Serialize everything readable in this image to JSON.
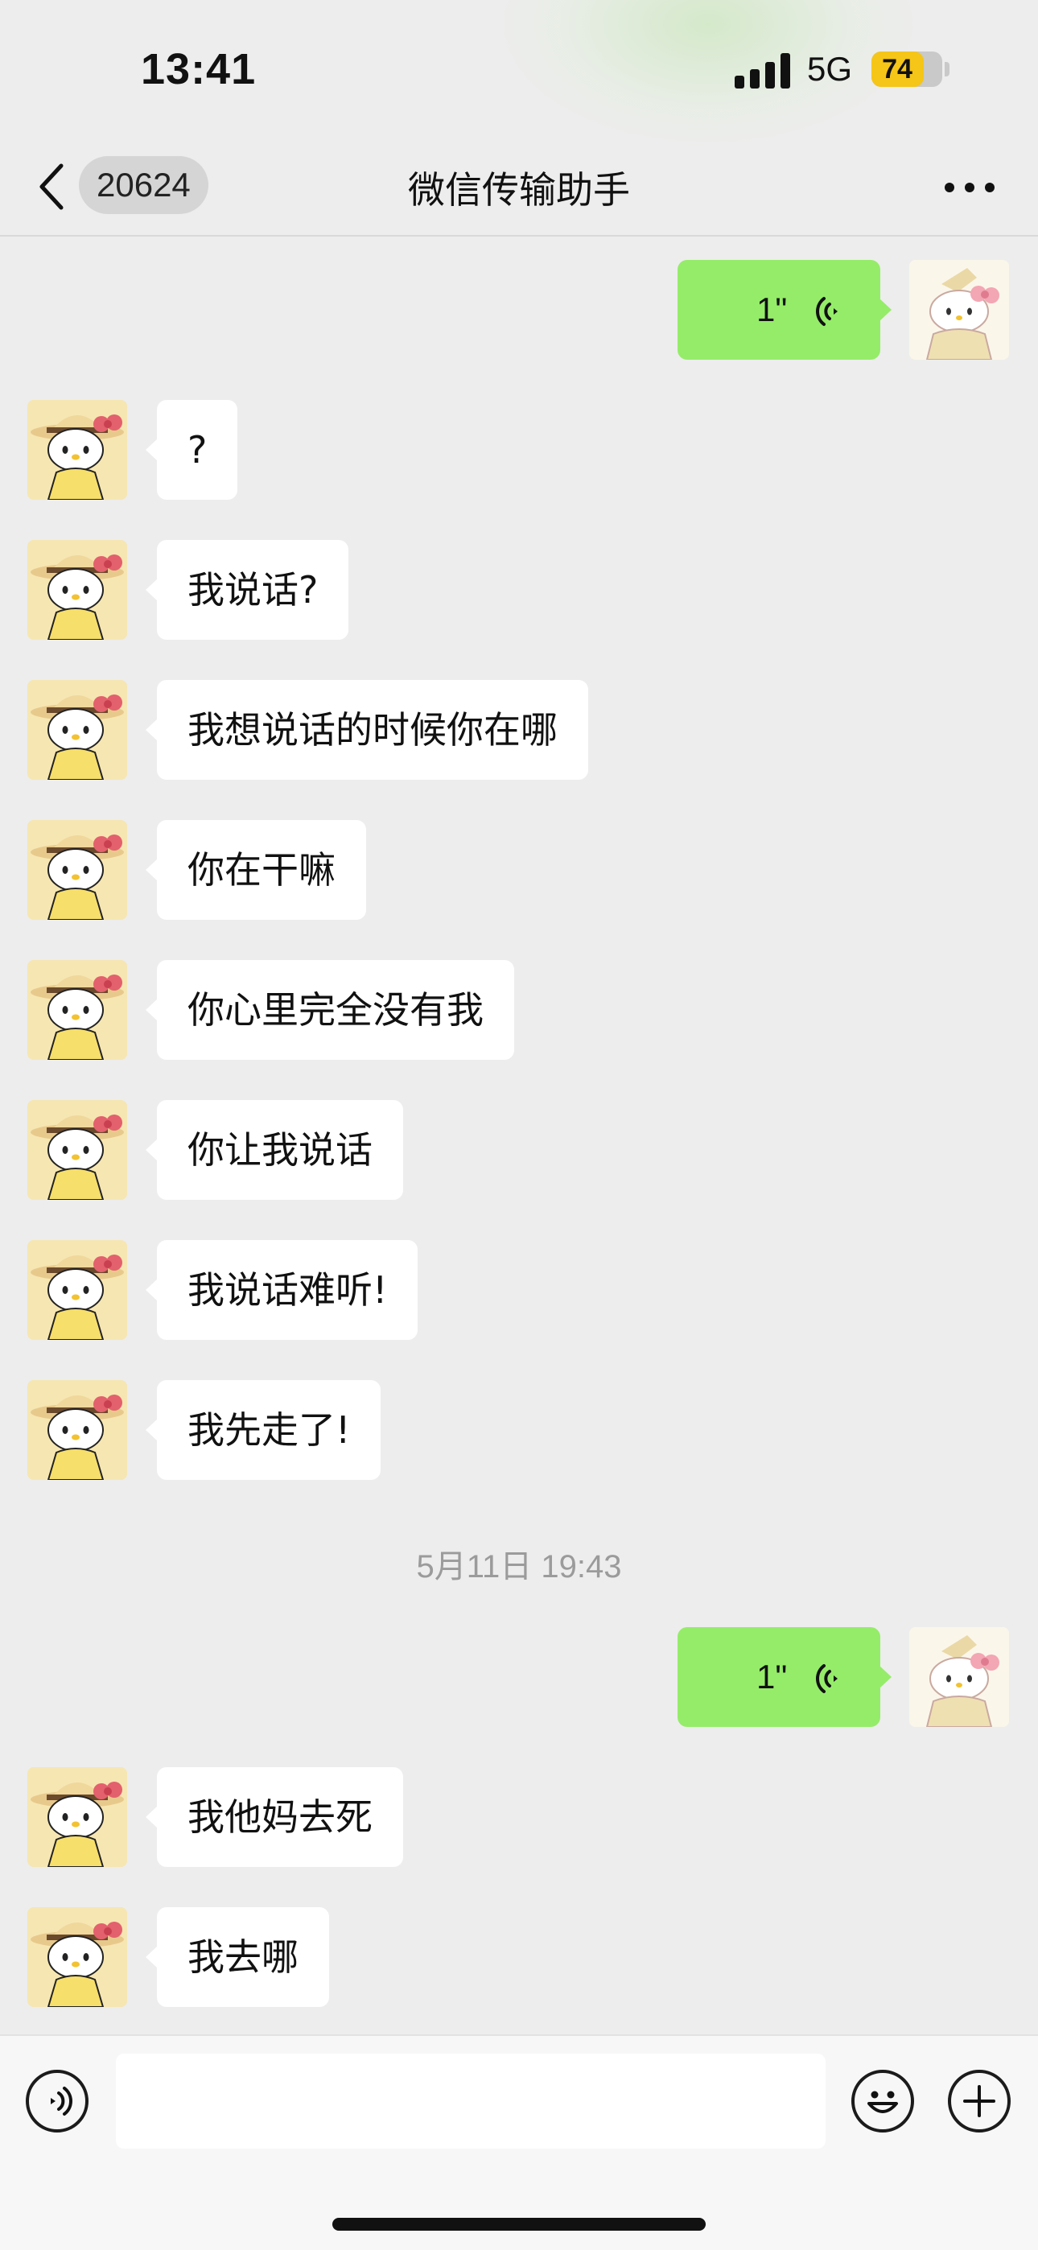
{
  "status_bar": {
    "time": "13:41",
    "network": "5G",
    "battery": "74",
    "battery_level": 0.74,
    "signal_bars": 4
  },
  "header": {
    "back_count": "20624",
    "title": "微信传输助手",
    "more_icon": "more-dots-icon"
  },
  "messages": [
    {
      "side": "right",
      "type": "voice",
      "duration": "1\""
    },
    {
      "side": "left",
      "type": "text",
      "text": "?"
    },
    {
      "side": "left",
      "type": "text",
      "text": "我说话?"
    },
    {
      "side": "left",
      "type": "text",
      "text": "我想说话的时候你在哪"
    },
    {
      "side": "left",
      "type": "text",
      "text": "你在干嘛"
    },
    {
      "side": "left",
      "type": "text",
      "text": "你心里完全没有我"
    },
    {
      "side": "left",
      "type": "text",
      "text": "你让我说话"
    },
    {
      "side": "left",
      "type": "text",
      "text": "我说话难听!"
    },
    {
      "side": "left",
      "type": "text",
      "text": "我先走了!"
    },
    {
      "type": "timestamp",
      "text": "5月11日 19:43"
    },
    {
      "side": "right",
      "type": "voice",
      "duration": "1\""
    },
    {
      "side": "left",
      "type": "text",
      "text": "我他妈去死"
    },
    {
      "side": "left",
      "type": "text",
      "text": "我去哪"
    }
  ],
  "input_bar": {
    "voice_icon": "voice-input-icon",
    "emoji_icon": "emoji-icon",
    "plus_icon": "plus-icon",
    "placeholder": ""
  },
  "colors": {
    "background": "#ededed",
    "sent_bubble": "#95ec69",
    "received_bubble": "#ffffff",
    "battery_fill": "#f5c518"
  }
}
